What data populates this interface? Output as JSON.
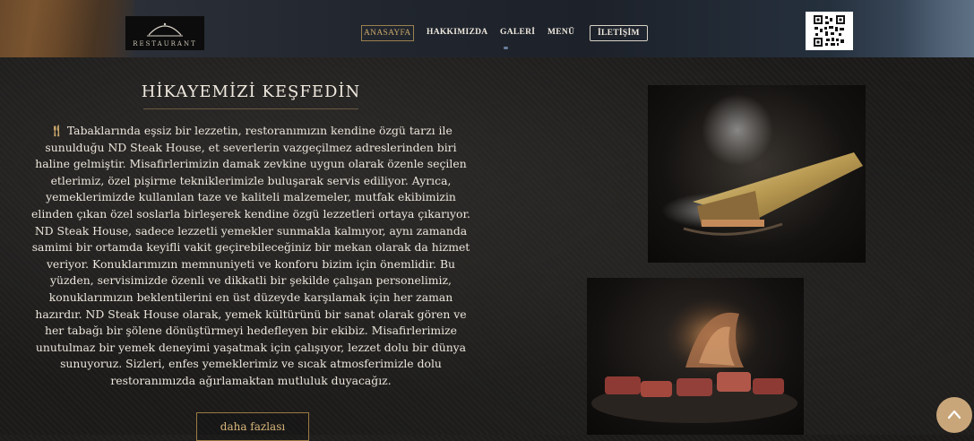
{
  "header": {
    "logo_text": "RESTAURANT",
    "nav": [
      {
        "label": "ANASAYFA"
      },
      {
        "label": "HAKKIMIZDA"
      },
      {
        "label": "GALERİ"
      },
      {
        "label": "MENÜ"
      },
      {
        "label": "İLETİŞİM"
      }
    ],
    "qr_icon": "qr-code-icon"
  },
  "main": {
    "title": "HİKAYEMİZİ KEŞFEDİN",
    "story_icon": "utensils-icon",
    "story": "Tabaklarında eşsiz bir lezzetin, restoranımızın kendine özgü tarzı ile sunulduğu ND Steak House, et severlerin vazgeçilmez adreslerinden biri haline gelmiştir. Misafirlerimizin damak zevkine uygun olarak özenle seçilen etlerimiz, özel pişirme tekniklerimizle buluşarak servis ediliyor. Ayrıca, yemeklerimizde kullanılan taze ve kaliteli malzemeler, mutfak ekibimizin elinden çıkan özel soslarla birleşerek kendine özgü lezzetleri ortaya çıkarıyor. ND Steak House, sadece lezzetli yemekler sunmakla kalmıyor, aynı zamanda samimi bir ortamda keyifli vakit geçirebileceğiniz bir mekan olarak da hizmet veriyor. Konuklarımızın memnuniyeti ve konforu bizim için önemlidir. Bu yüzden, servisimizde özenli ve dikkatli bir şekilde çalışan personelimiz, konuklarımızın beklentilerini en üst düzeyde karşılamak için her zaman hazırdır. ND Steak House olarak, yemek kültürünü bir sanat olarak gören ve her tabağı bir şölene dönüştürmeyi hedefleyen bir ekibiz. Misafirlerimize unutulmaz bir yemek deneyimi yaşatmak için çalışıyor, lezzet dolu bir dünya sunuyoruz. Sizleri, enfes yemeklerimiz ve sıcak atmosferimizle dolu restoranımızda ağırlamaktan mutluluk duyacağız.",
    "more_label": "daha fazlası"
  },
  "colors": {
    "accent": "#c9a66b",
    "background": "#1c1b1a",
    "to_top_button": "#c9a67a"
  }
}
